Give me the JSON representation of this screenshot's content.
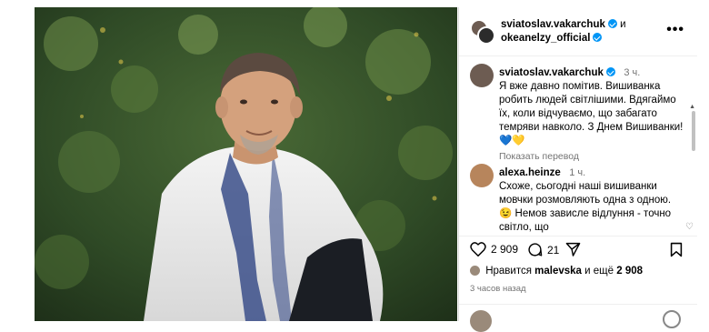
{
  "post": {
    "author1": "sviatoslav.vakarchuk",
    "and": "и",
    "author2": "okeanelzy_official",
    "more": "•••"
  },
  "comments": [
    {
      "user": "sviatoslav.vakarchuk",
      "time": "3 ч.",
      "text": "Я вже давно помітив. Вишиванка робить людей світлішими. Вдягаймо їх, коли відчуваємо, що забагато темряви навколо. З Днем Вишиванки!",
      "emoji": "💙💛",
      "translate": "Показать перевод"
    },
    {
      "user": "alexa.heinze",
      "time": "1 ч.",
      "text": "Схоже, сьогодні наші вишиванки мовчки розмовляють одна з одною.😉  Немов зависле відлуння - точно світло, що"
    }
  ],
  "actions": {
    "likes_count": "2 909",
    "comments_count": "21"
  },
  "likes": {
    "prefix": "Нравится",
    "user": "malevska",
    "suffix": "и ещё",
    "count": "2 908"
  },
  "time_ago": "3 часов назад"
}
